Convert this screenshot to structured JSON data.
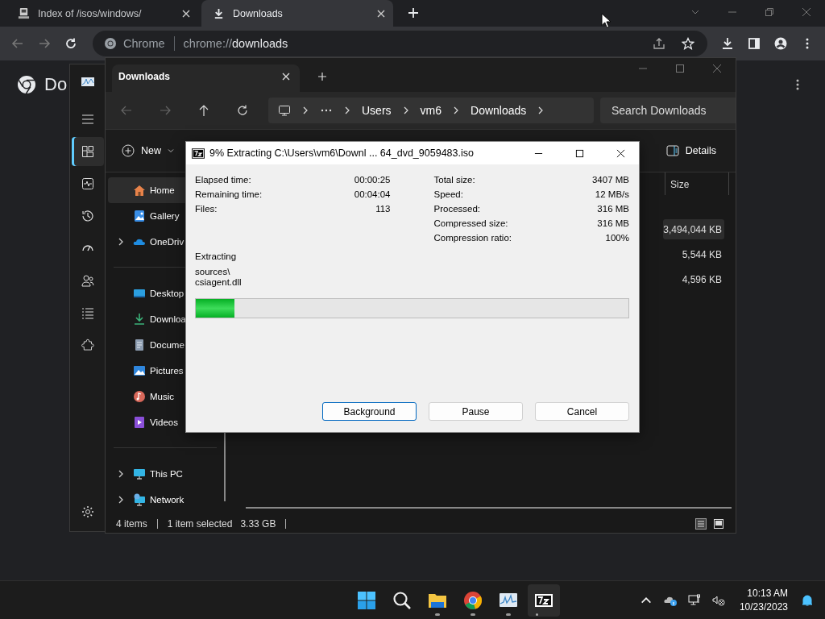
{
  "browser": {
    "tabs": [
      {
        "title": "Index of /isos/windows/",
        "selected": false
      },
      {
        "title": "Downloads",
        "selected": true
      }
    ],
    "omnibox": {
      "chip": "Chrome",
      "scheme": "chrome://",
      "path": "downloads"
    },
    "page_heading": "Do"
  },
  "task_manager": {
    "nav": [
      {
        "selected": true
      },
      {
        "selected": false
      },
      {
        "selected": false
      },
      {
        "selected": false
      },
      {
        "selected": false
      },
      {
        "selected": false
      },
      {
        "selected": false
      }
    ]
  },
  "explorer": {
    "tab_title": "Downloads",
    "breadcrumb": [
      "Users",
      "vm6",
      "Downloads"
    ],
    "search": {
      "placeholder": "Search Downloads"
    },
    "new_label": "New",
    "details_label": "Details",
    "nav_sections": [
      {
        "items": [
          {
            "label": "Home",
            "kind": "link",
            "selected": true
          },
          {
            "label": "Gallery",
            "kind": "link",
            "selected": false
          },
          {
            "label": "OneDriv",
            "kind": "tree",
            "expanded": false,
            "selected": false
          }
        ]
      },
      {
        "items": [
          {
            "label": "Desktop",
            "kind": "link",
            "selected": false
          },
          {
            "label": "Downloa",
            "kind": "link",
            "selected": false
          },
          {
            "label": "Docume",
            "kind": "link",
            "selected": false
          },
          {
            "label": "Pictures",
            "kind": "link",
            "selected": false
          },
          {
            "label": "Music",
            "kind": "link",
            "selected": false
          },
          {
            "label": "Videos",
            "kind": "link",
            "selected": false
          }
        ]
      },
      {
        "items": [
          {
            "label": "This PC",
            "kind": "tree",
            "expanded": false,
            "selected": false
          },
          {
            "label": "Network",
            "kind": "tree",
            "expanded": false,
            "selected": false
          }
        ]
      }
    ],
    "size_header": "Size",
    "rows": [
      {
        "size": "3,494,044 KB",
        "selected": true
      },
      {
        "size": "5,544 KB",
        "selected": false
      },
      {
        "size": "4,596 KB",
        "selected": false
      }
    ],
    "status": {
      "item_count": "4 items",
      "selection": "1 item selected",
      "selection_size": "3.33 GB"
    }
  },
  "dialog": {
    "title": "9% Extracting C:\\Users\\vm6\\Downl ... 64_dvd_9059483.iso",
    "stats_left": [
      {
        "label": "Elapsed time:",
        "value": "00:00:25"
      },
      {
        "label": "Remaining time:",
        "value": "00:04:04"
      },
      {
        "label": "Files:",
        "value": "113"
      }
    ],
    "stats_right": [
      {
        "label": "Total size:",
        "value": "3407 MB"
      },
      {
        "label": "Speed:",
        "value": "12 MB/s"
      },
      {
        "label": "Processed:",
        "value": "316 MB"
      },
      {
        "label": "Compressed size:",
        "value": "316 MB"
      },
      {
        "label": "Compression ratio:",
        "value": "100%"
      }
    ],
    "action": "Extracting",
    "current_path": [
      "sources\\",
      "csiagent.dll"
    ],
    "level": 0.09,
    "buttons": [
      {
        "label": "Background",
        "focused": true
      },
      {
        "label": "Pause",
        "focused": false
      },
      {
        "label": "Cancel",
        "focused": false
      }
    ]
  },
  "taskbar": {
    "apps": [
      {
        "running": false,
        "selected": false
      },
      {
        "running": false,
        "selected": false
      },
      {
        "running": true,
        "selected": false
      },
      {
        "running": true,
        "selected": false
      },
      {
        "running": true,
        "selected": false
      },
      {
        "running": true,
        "selected": true
      }
    ],
    "time": "10:13 AM",
    "date": "10/23/2023"
  }
}
